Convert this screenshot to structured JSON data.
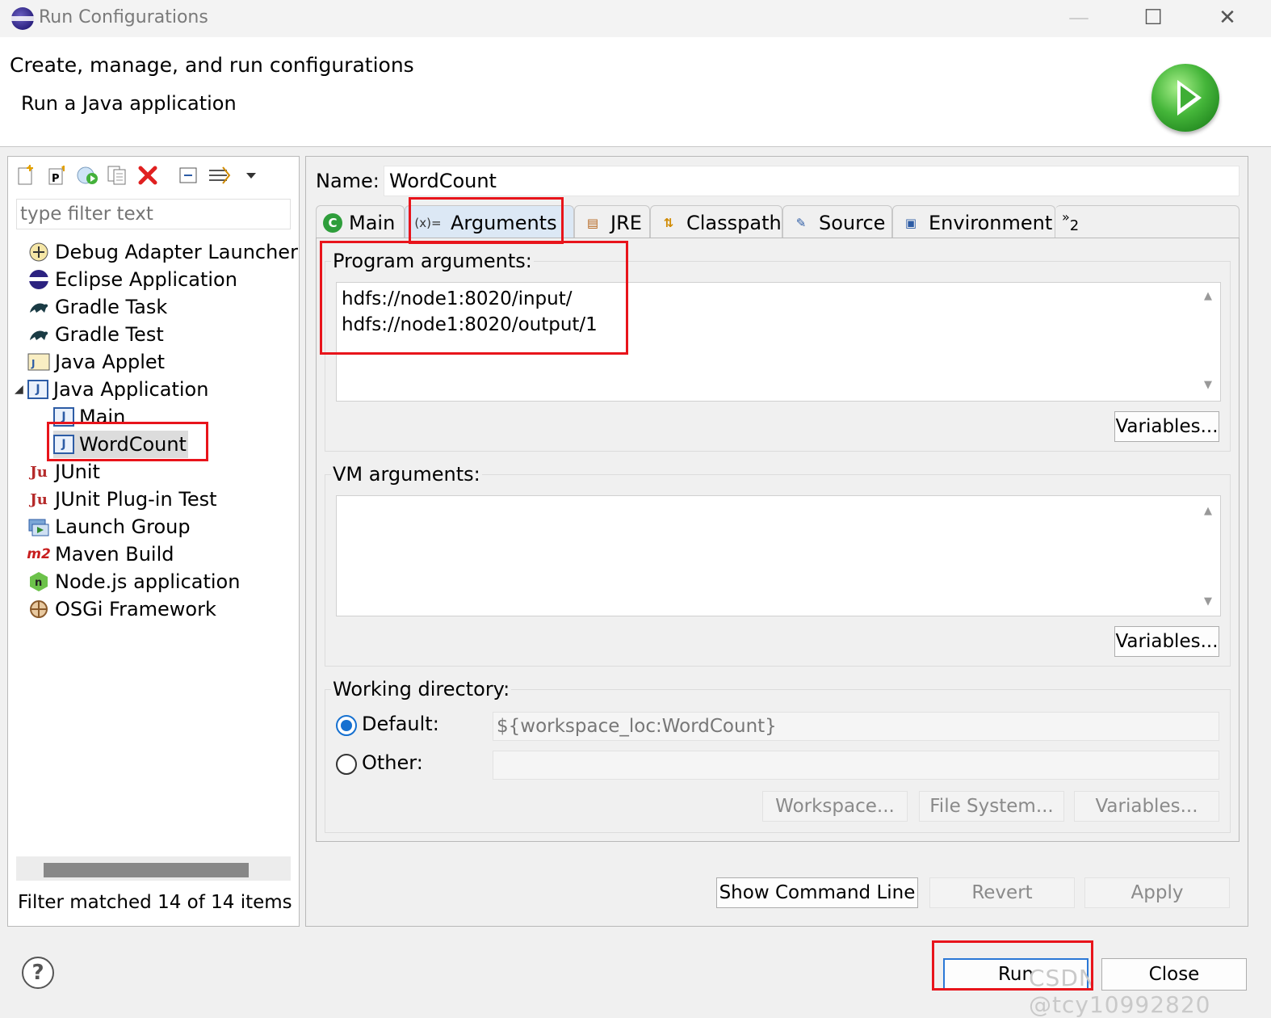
{
  "window": {
    "title": "Run Configurations",
    "maximize_glyph": "☐",
    "close_glyph": "✕",
    "minimize_glyph": "—"
  },
  "banner": {
    "title": "Create, manage, and run configurations",
    "subtitle": "Run a Java application"
  },
  "left": {
    "toolbar_icons": [
      "new-launch-config-icon",
      "new-prototype-icon",
      "export-icon",
      "duplicate-icon",
      "delete-icon",
      "collapse-all-icon",
      "filter-icon",
      "view-menu-icon"
    ],
    "filter_placeholder": "type filter text",
    "tree": [
      {
        "label": "Debug Adapter Launcher",
        "icon": "debug-adapter-icon"
      },
      {
        "label": "Eclipse Application",
        "icon": "eclipse-icon"
      },
      {
        "label": "Gradle Task",
        "icon": "gradle-icon"
      },
      {
        "label": "Gradle Test",
        "icon": "gradle-icon"
      },
      {
        "label": "Java Applet",
        "icon": "java-applet-icon"
      },
      {
        "label": "Java Application",
        "icon": "java-app-icon",
        "expanded": true
      },
      {
        "label": "Main",
        "icon": "java-app-icon",
        "child": true
      },
      {
        "label": "WordCount",
        "icon": "java-app-icon",
        "child": true,
        "selected": true
      },
      {
        "label": "JUnit",
        "icon": "junit-icon"
      },
      {
        "label": "JUnit Plug-in Test",
        "icon": "junit-plugin-icon"
      },
      {
        "label": "Launch Group",
        "icon": "launch-group-icon"
      },
      {
        "label": "Maven Build",
        "icon": "maven-icon"
      },
      {
        "label": "Node.js application",
        "icon": "nodejs-icon"
      },
      {
        "label": "OSGi Framework",
        "icon": "osgi-icon"
      }
    ],
    "status": "Filter matched 14 of 14 items"
  },
  "right": {
    "name_label": "Name:",
    "name_value": "WordCount",
    "tabs": [
      {
        "label": "Main",
        "icon": "main-tab-icon",
        "icon_text": "C"
      },
      {
        "label": "Arguments",
        "icon": "arguments-tab-icon",
        "icon_text": "(x)=",
        "active": true
      },
      {
        "label": "JRE",
        "icon": "jre-tab-icon",
        "icon_text": "▤"
      },
      {
        "label": "Classpath",
        "icon": "classpath-tab-icon",
        "icon_text": "⇅"
      },
      {
        "label": "Source",
        "icon": "source-tab-icon",
        "icon_text": "✎"
      },
      {
        "label": "Environment",
        "icon": "environment-tab-icon",
        "icon_text": "▣"
      }
    ],
    "tab_overflow": "»",
    "tab_overflow_count": "2",
    "program_args": {
      "label": "Program arguments:",
      "value": "hdfs://node1:8020/input/\nhdfs://node1:8020/output/1",
      "variables_button": "Variables..."
    },
    "vm_args": {
      "label": "VM arguments:",
      "value": "",
      "variables_button": "Variables..."
    },
    "working_dir": {
      "label": "Working directory:",
      "default_label": "Default:",
      "default_value": "${workspace_loc:WordCount}",
      "other_label": "Other:",
      "other_value": "",
      "workspace_button": "Workspace...",
      "filesystem_button": "File System...",
      "variables_button": "Variables..."
    },
    "show_cmd_button": "Show Command Line",
    "revert_button": "Revert",
    "apply_button": "Apply"
  },
  "footer": {
    "help_glyph": "?",
    "run_button": "Run",
    "close_button": "Close",
    "watermark": "CSDN @tcy10992820"
  },
  "colors": {
    "highlight": "#e8141b",
    "selection": "#dce8f5",
    "radio_accent": "#1570d0"
  }
}
